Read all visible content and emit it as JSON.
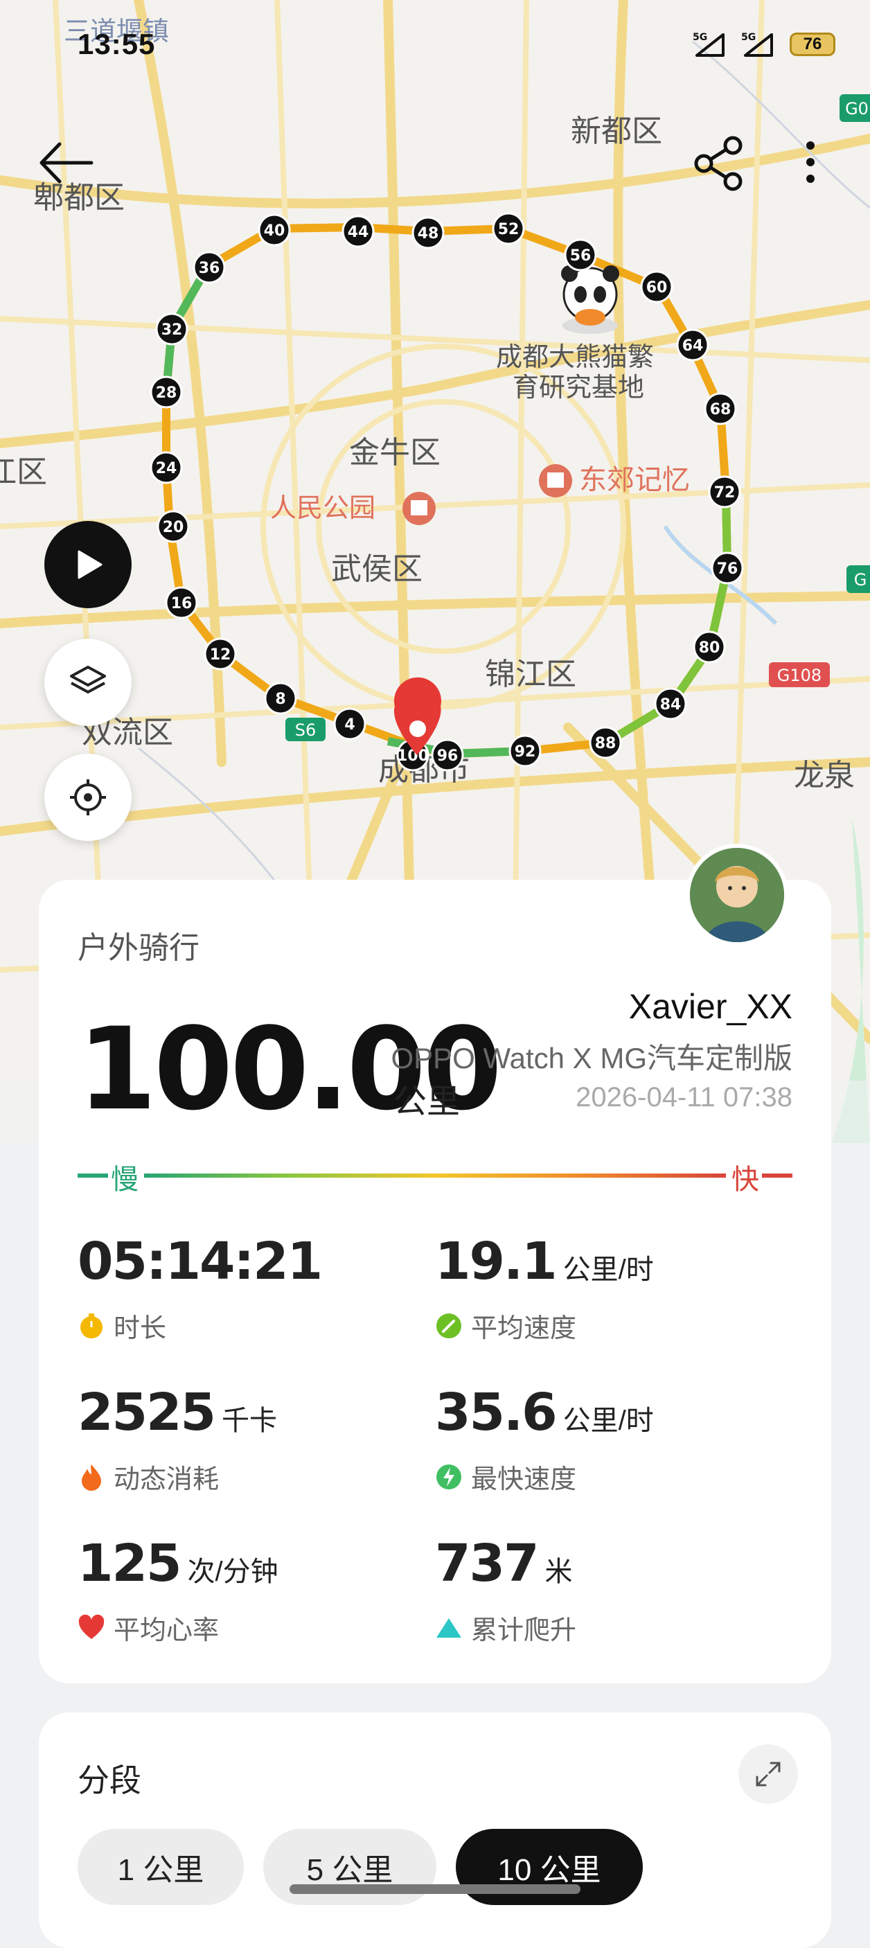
{
  "status_bar": {
    "time": "13:55",
    "signal_1": "5G",
    "signal_2": "5G",
    "battery": "76"
  },
  "map": {
    "labels": [
      {
        "text": "三道堰镇"
      },
      {
        "text": "郫都区"
      },
      {
        "text": "新都区"
      },
      {
        "text": "成都大熊猫繁"
      },
      {
        "text": "育研究基地"
      },
      {
        "text": "金牛区"
      },
      {
        "text": "人民公园"
      },
      {
        "text": "东郊记忆"
      },
      {
        "text": "武侯区"
      },
      {
        "text": "锦江区"
      },
      {
        "text": "双流区"
      },
      {
        "text": "成都市"
      },
      {
        "text": "龙泉"
      },
      {
        "text": "江区"
      }
    ],
    "road_badges": [
      "S6",
      "G108",
      "G0",
      "G"
    ],
    "km_markers": [
      "4",
      "8",
      "12",
      "16",
      "20",
      "24",
      "28",
      "32",
      "36",
      "40",
      "44",
      "48",
      "52",
      "56",
      "60",
      "64",
      "68",
      "72",
      "76",
      "80",
      "84",
      "88",
      "92",
      "96",
      "100"
    ]
  },
  "summary": {
    "activity_type": "户外骑行",
    "distance": "100.00",
    "distance_unit": "公里",
    "user_name": "Xavier_XX",
    "device": "OPPO Watch X MG汽车定制版",
    "datetime": "2026-04-11 07:38",
    "speed_scale": {
      "slow": "慢",
      "fast": "快"
    },
    "stats": {
      "duration": {
        "value": "05:14:21",
        "unit": "",
        "label": "时长"
      },
      "avg_speed": {
        "value": "19.1",
        "unit": "公里/时",
        "label": "平均速度"
      },
      "calories": {
        "value": "2525",
        "unit": "千卡",
        "label": "动态消耗"
      },
      "max_speed": {
        "value": "35.6",
        "unit": "公里/时",
        "label": "最快速度"
      },
      "avg_hr": {
        "value": "125",
        "unit": "次/分钟",
        "label": "平均心率"
      },
      "climb": {
        "value": "737",
        "unit": "米",
        "label": "累计爬升"
      }
    }
  },
  "segments": {
    "title": "分段",
    "tabs": [
      "1 公里",
      "5 公里",
      "10 公里"
    ],
    "selected": "10 公里"
  },
  "colors": {
    "slow": "#27a574",
    "fast": "#d9453a",
    "pin": "#e53935"
  }
}
